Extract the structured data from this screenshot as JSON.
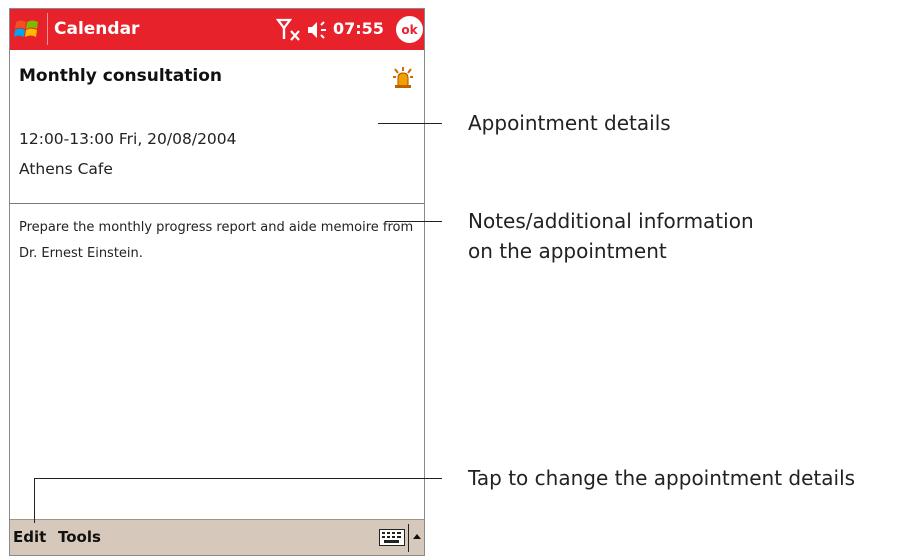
{
  "titlebar": {
    "app_title": "Calendar",
    "clock": "07:55",
    "ok_label": "ok",
    "color": "#e8222b"
  },
  "appointment": {
    "title": "Monthly consultation",
    "time": "12:00-13:00 Fri, 20/08/2004",
    "location": "Athens Cafe",
    "notes": "Prepare the monthly progress report and aide memoire from Dr. Ernest Einstein."
  },
  "menubar": {
    "edit_label": "Edit",
    "tools_label": "Tools"
  },
  "callouts": {
    "details": "Appointment details",
    "notes_line1": "Notes/additional information",
    "notes_line2": "on the appointment",
    "edit": "Tap to change the appointment details"
  },
  "icons": [
    "windows-start-icon",
    "signal-icon",
    "volume-icon",
    "alarm-bell-icon",
    "keyboard-icon",
    "up-arrow-icon"
  ]
}
